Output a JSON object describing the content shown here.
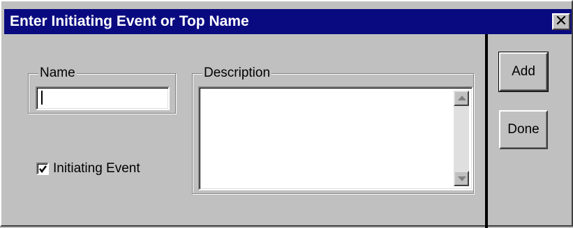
{
  "window": {
    "title": "Enter Initiating Event or Top Name",
    "close_symbol": "✕"
  },
  "name_group": {
    "legend": "Name",
    "input_value": ""
  },
  "description_group": {
    "legend": "Description",
    "text_value": ""
  },
  "initiating_event": {
    "label": "Initiating Event",
    "checked": true
  },
  "buttons": {
    "add_label": "Add",
    "done_label": "Done"
  },
  "icons": {
    "close": "close-icon",
    "scroll_up": "scroll-up-arrow-icon",
    "scroll_down": "scroll-down-arrow-icon",
    "checkmark": "checkmark-icon"
  },
  "colors": {
    "titlebar": "#0a0a80",
    "face": "#c0c0c0",
    "field": "#ffffff"
  }
}
